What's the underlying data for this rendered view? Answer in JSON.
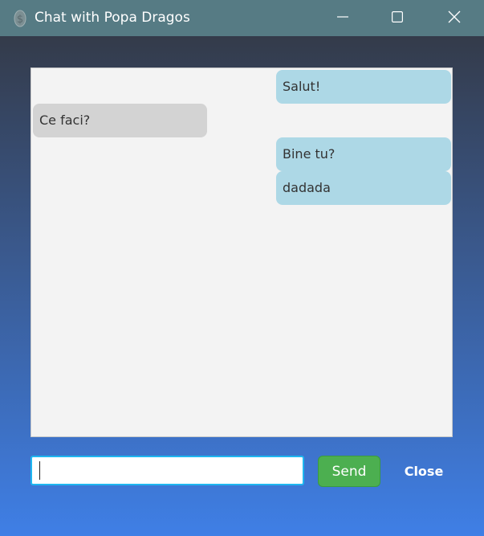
{
  "window": {
    "title": "Chat with Popa Dragos",
    "icons": {
      "app": "dollar-icon",
      "minimize": "minimize-icon",
      "maximize": "maximize-icon",
      "close": "close-icon"
    }
  },
  "chat": {
    "messages": [
      {
        "text": "Salut!",
        "from": "me"
      },
      {
        "text": "Ce faci?",
        "from": "other"
      },
      {
        "text": "Bine tu?",
        "from": "me"
      },
      {
        "text": "dadada",
        "from": "me"
      }
    ]
  },
  "composer": {
    "input_value": "",
    "send_label": "Send",
    "close_label": "Close"
  },
  "colors": {
    "titlebar": "#567b84",
    "sent_bubble": "#add8e6",
    "received_bubble": "#d3d3d3",
    "send_button": "#4caf50",
    "input_border": "#1fb6f0",
    "background_top": "#343b4a",
    "background_bottom": "#3f7fe6"
  }
}
